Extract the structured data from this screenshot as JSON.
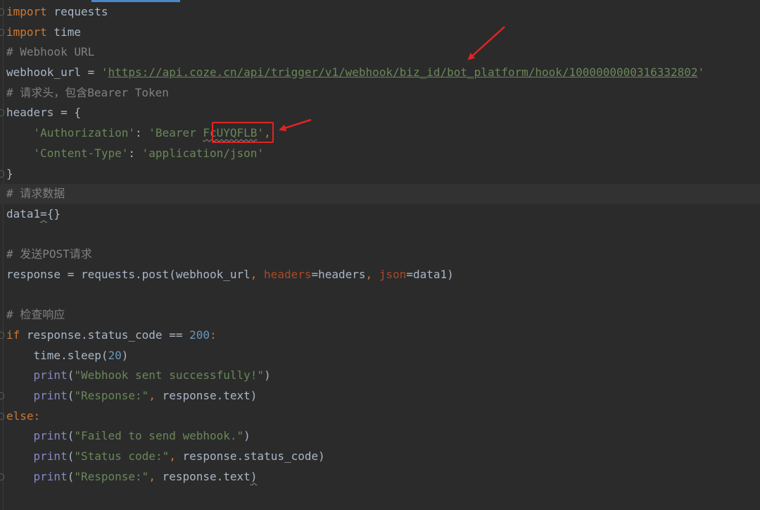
{
  "editor": {
    "lines": [
      {
        "segments": [
          {
            "t": "import",
            "c": "kw"
          },
          {
            "t": " requests"
          }
        ],
        "fold": true
      },
      {
        "segments": [
          {
            "t": "import",
            "c": "kw"
          },
          {
            "t": " time"
          }
        ],
        "fold": true
      },
      {
        "segments": [
          {
            "t": "# Webhook URL",
            "c": "cmt"
          }
        ]
      },
      {
        "segments": [
          {
            "t": "webhook_url = "
          },
          {
            "t": "'",
            "c": "str"
          },
          {
            "t": "https://api.coze.cn/api/trigger/v1/webhook/biz_id/bot_platform/hook/1000000000316332802",
            "c": "link"
          },
          {
            "t": "'",
            "c": "str"
          }
        ]
      },
      {
        "segments": [
          {
            "t": "# 请求头，包含Bearer Token",
            "c": "cmt"
          }
        ]
      },
      {
        "segments": [
          {
            "t": "headers = {"
          }
        ],
        "fold": true
      },
      {
        "segments": [
          {
            "t": "    "
          },
          {
            "t": "'Authorization'",
            "c": "str"
          },
          {
            "t": ": "
          },
          {
            "t": "'Bearer ",
            "c": "str"
          },
          {
            "t": "FcUYQFLB",
            "c": "str squiggle"
          },
          {
            "t": "'",
            "c": "str"
          },
          {
            "t": ",",
            "c": "kw"
          }
        ]
      },
      {
        "segments": [
          {
            "t": "    "
          },
          {
            "t": "'Content-Type'",
            "c": "str"
          },
          {
            "t": ": "
          },
          {
            "t": "'application/json'",
            "c": "str"
          }
        ]
      },
      {
        "segments": [
          {
            "t": "}"
          }
        ],
        "fold": true
      },
      {
        "segments": [
          {
            "t": "# 请求数据",
            "c": "cmt"
          }
        ],
        "highlight": true
      },
      {
        "segments": [
          {
            "t": "data1"
          },
          {
            "t": "=",
            "c": "squiggle"
          },
          {
            "t": "{}"
          }
        ]
      },
      {
        "segments": [
          {
            "t": ""
          }
        ]
      },
      {
        "segments": [
          {
            "t": "# 发送POST请求",
            "c": "cmt"
          }
        ]
      },
      {
        "segments": [
          {
            "t": "response = requests.post(webhook_url"
          },
          {
            "t": ", ",
            "c": "kw"
          },
          {
            "t": "headers",
            "c": "kwarg"
          },
          {
            "t": "=headers"
          },
          {
            "t": ", ",
            "c": "kw"
          },
          {
            "t": "json",
            "c": "kwarg"
          },
          {
            "t": "=data1)"
          }
        ]
      },
      {
        "segments": [
          {
            "t": ""
          }
        ]
      },
      {
        "segments": [
          {
            "t": "# 检查响应",
            "c": "cmt"
          }
        ]
      },
      {
        "segments": [
          {
            "t": "if",
            "c": "kw"
          },
          {
            "t": " response.status_code == "
          },
          {
            "t": "200",
            "c": "num"
          },
          {
            "t": ":",
            "c": "kw"
          }
        ],
        "fold": true
      },
      {
        "segments": [
          {
            "t": "    time.sleep("
          },
          {
            "t": "20",
            "c": "num"
          },
          {
            "t": ")"
          }
        ]
      },
      {
        "segments": [
          {
            "t": "    "
          },
          {
            "t": "print",
            "c": "builtin"
          },
          {
            "t": "("
          },
          {
            "t": "\"Webhook sent successfully!\"",
            "c": "str"
          },
          {
            "t": ")"
          }
        ]
      },
      {
        "segments": [
          {
            "t": "    "
          },
          {
            "t": "print",
            "c": "builtin"
          },
          {
            "t": "("
          },
          {
            "t": "\"Response:\"",
            "c": "str"
          },
          {
            "t": ", ",
            "c": "kw"
          },
          {
            "t": "response.text)"
          }
        ],
        "fold": true
      },
      {
        "segments": [
          {
            "t": "else",
            "c": "kw"
          },
          {
            "t": ":",
            "c": "kw"
          }
        ],
        "fold": true
      },
      {
        "segments": [
          {
            "t": "    "
          },
          {
            "t": "print",
            "c": "builtin"
          },
          {
            "t": "("
          },
          {
            "t": "\"Failed to send webhook.\"",
            "c": "str"
          },
          {
            "t": ")"
          }
        ]
      },
      {
        "segments": [
          {
            "t": "    "
          },
          {
            "t": "print",
            "c": "builtin"
          },
          {
            "t": "("
          },
          {
            "t": "\"Status code:\"",
            "c": "str"
          },
          {
            "t": ", ",
            "c": "kw"
          },
          {
            "t": "response.status_code)"
          }
        ]
      },
      {
        "segments": [
          {
            "t": "    "
          },
          {
            "t": "print",
            "c": "builtin"
          },
          {
            "t": "("
          },
          {
            "t": "\"Response:\"",
            "c": "str"
          },
          {
            "t": ", ",
            "c": "kw"
          },
          {
            "t": "response.text"
          },
          {
            "t": ")",
            "c": "squiggle"
          }
        ],
        "fold": true
      }
    ]
  },
  "colors": {
    "background": "#2b2b2b",
    "keyword": "#cc7832",
    "string": "#6a8759",
    "comment": "#808080",
    "number": "#6897bb",
    "builtin": "#8888c6",
    "kwarg": "#aa4926",
    "default_text": "#a9b7c6",
    "annotation": "#e02424"
  },
  "annotations": {
    "arrows": [
      "arrow-to-webhook-url",
      "arrow-to-bearer-token"
    ],
    "highlight_box": "bearer-token-box"
  }
}
